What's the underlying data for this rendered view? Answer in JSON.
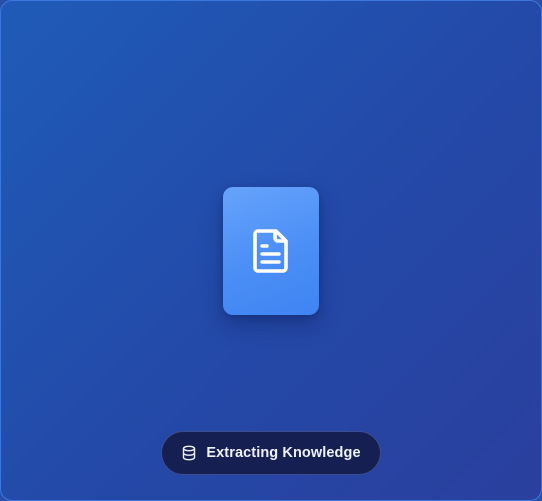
{
  "status": {
    "label": "Extracting Knowledge",
    "icon": "database-icon"
  },
  "document": {
    "icon": "document-icon"
  },
  "colors": {
    "background": "#2449a8",
    "card_accent": "#4b8ef6",
    "pill_background": "#161f52",
    "text": "#eef2ff"
  }
}
